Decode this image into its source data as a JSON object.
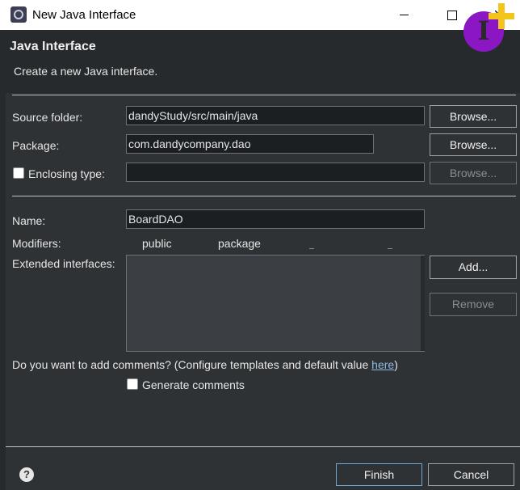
{
  "window": {
    "title": "New Java Interface"
  },
  "header": {
    "title": "Java Interface",
    "description": "Create a new Java interface.",
    "icon_letter": "I",
    "accent_color": "#8b17c4",
    "plus_color": "#f3c51c"
  },
  "form": {
    "source_folder": {
      "label": "Source folder:",
      "value": "dandyStudy/src/main/java",
      "browse": "Browse..."
    },
    "package": {
      "label": "Package:",
      "value": "com.dandycompany.dao",
      "browse": "Browse..."
    },
    "enclosing": {
      "label": "Enclosing type:",
      "value": "",
      "browse": "Browse..."
    },
    "name": {
      "label": "Name:",
      "value": "BoardDAO"
    },
    "modifiers": {
      "label": "Modifiers:",
      "public": "public",
      "package": "package"
    },
    "extended": {
      "label": "Extended interfaces:",
      "add": "Add...",
      "remove": "Remove"
    },
    "comments": {
      "question": "Do you want to add comments? (Configure templates and default value ",
      "link": "here",
      "suffix": ")",
      "generate": "Generate comments"
    }
  },
  "footer": {
    "finish": "Finish",
    "cancel": "Cancel",
    "help": "?"
  }
}
